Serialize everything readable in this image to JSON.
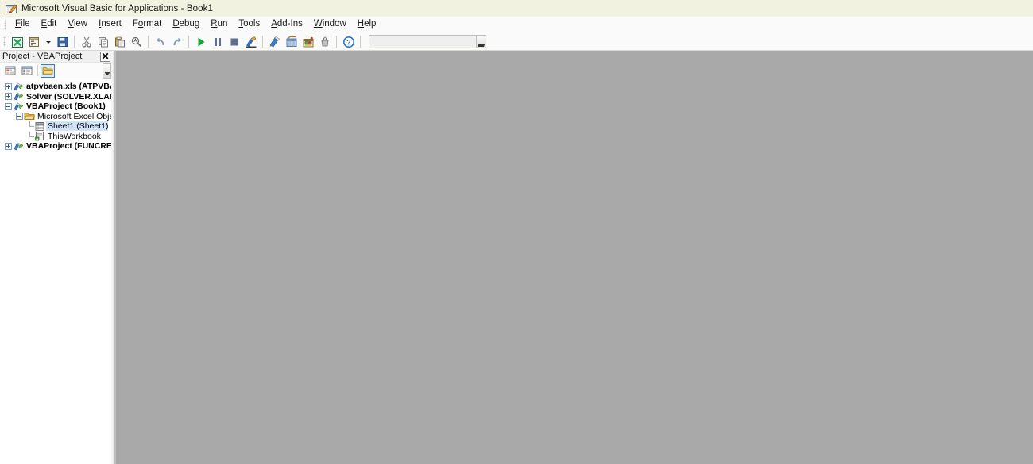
{
  "window": {
    "title": "Microsoft Visual Basic for Applications - Book1",
    "app_icon": "vba-app-icon"
  },
  "menubar": {
    "items": [
      {
        "label": "File",
        "accel": "F"
      },
      {
        "label": "Edit",
        "accel": "E"
      },
      {
        "label": "View",
        "accel": "V"
      },
      {
        "label": "Insert",
        "accel": "I"
      },
      {
        "label": "Format",
        "accel": "o"
      },
      {
        "label": "Debug",
        "accel": "D"
      },
      {
        "label": "Run",
        "accel": "R"
      },
      {
        "label": "Tools",
        "accel": "T"
      },
      {
        "label": "Add-Ins",
        "accel": "A"
      },
      {
        "label": "Window",
        "accel": "W"
      },
      {
        "label": "Help",
        "accel": "H"
      }
    ]
  },
  "toolbar": {
    "buttons": [
      {
        "name": "view-excel-icon",
        "title": "View Microsoft Excel"
      },
      {
        "name": "insert-userform-icon",
        "title": "Insert UserForm"
      },
      {
        "name": "insert-dropdown-icon",
        "title": "Insert"
      },
      {
        "name": "save-icon",
        "title": "Save Book1"
      },
      {
        "name": "cut-icon",
        "title": "Cut"
      },
      {
        "name": "copy-icon",
        "title": "Copy"
      },
      {
        "name": "paste-icon",
        "title": "Paste"
      },
      {
        "name": "find-icon",
        "title": "Find"
      },
      {
        "name": "undo-icon",
        "title": "Undo"
      },
      {
        "name": "redo-icon",
        "title": "Redo"
      },
      {
        "name": "run-icon",
        "title": "Run Sub/UserForm"
      },
      {
        "name": "break-icon",
        "title": "Break"
      },
      {
        "name": "reset-icon",
        "title": "Reset"
      },
      {
        "name": "design-mode-icon",
        "title": "Design Mode"
      },
      {
        "name": "project-explorer-icon",
        "title": "Project Explorer"
      },
      {
        "name": "properties-window-icon",
        "title": "Properties Window"
      },
      {
        "name": "object-browser-icon",
        "title": "Object Browser"
      },
      {
        "name": "toolbox-icon",
        "title": "Toolbox"
      },
      {
        "name": "help-icon",
        "title": "Microsoft Visual Basic for Applications Help"
      }
    ],
    "search_box": {
      "value": "",
      "placeholder": ""
    }
  },
  "project_panel": {
    "caption": "Project - VBAProject",
    "close_label": "✕",
    "toolbar": [
      {
        "name": "view-code-button",
        "label": "View Code",
        "active": false
      },
      {
        "name": "view-object-button",
        "label": "View Object",
        "active": false
      },
      {
        "name": "toggle-folders-button",
        "label": "Toggle Folders",
        "active": true
      }
    ],
    "tree": [
      {
        "id": "atpvbaen",
        "label": "atpvbaen.xls (ATPVBAEN",
        "icon": "vba-project-icon",
        "depth": 0,
        "expander": "plus",
        "bold": true,
        "selected": false
      },
      {
        "id": "solver",
        "label": "Solver (SOLVER.XLAM)",
        "icon": "vba-project-icon",
        "depth": 0,
        "expander": "plus",
        "bold": true,
        "selected": false
      },
      {
        "id": "vbaproject-book1",
        "label": "VBAProject (Book1)",
        "icon": "vba-project-icon",
        "depth": 0,
        "expander": "minus",
        "bold": true,
        "selected": false
      },
      {
        "id": "excel-objects",
        "label": "Microsoft Excel Objects",
        "icon": "folder-icon",
        "depth": 1,
        "expander": "minus",
        "bold": false,
        "selected": false
      },
      {
        "id": "sheet1",
        "label": "Sheet1 (Sheet1)",
        "icon": "worksheet-icon",
        "depth": 2,
        "expander": "none",
        "bold": false,
        "selected": true
      },
      {
        "id": "thisworkbook",
        "label": "ThisWorkbook",
        "icon": "workbook-icon",
        "depth": 2,
        "expander": "none",
        "bold": false,
        "selected": false
      },
      {
        "id": "vbaproject-funcres",
        "label": "VBAProject (FUNCRES.XL",
        "icon": "vba-project-icon",
        "depth": 0,
        "expander": "plus",
        "bold": true,
        "selected": false
      }
    ]
  },
  "mdi": {
    "background_color": "#a9a9a9",
    "open_documents": []
  },
  "colors": {
    "titlebar": "#f2f2e0",
    "menubar": "#fafafa",
    "toolbar": "#fafafa",
    "panel_background": "#ffffff",
    "mdi_background": "#a9a9a9",
    "selection": "#cfe3fa",
    "active_button_border": "#3a7cc4"
  }
}
